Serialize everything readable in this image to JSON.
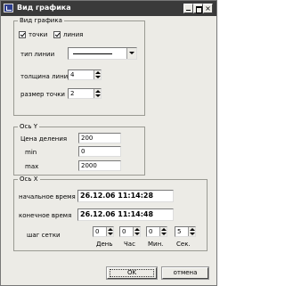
{
  "window": {
    "title": "Вид графика"
  },
  "view_group": {
    "legend": "Вид графика",
    "points_label": "точки",
    "line_label": "линия",
    "line_type_label": "тип линии",
    "line_width_label": "толщина линии",
    "line_width_value": "4",
    "point_size_label": "размер точки",
    "point_size_value": "2"
  },
  "y_group": {
    "legend": "Ось Y",
    "division_label": "Цена деления",
    "division_value": "200",
    "min_label": "min",
    "min_value": "0",
    "max_label": "max",
    "max_value": "2000"
  },
  "x_group": {
    "legend": "Ось X",
    "start_label": "начальное время",
    "start_value": "26.12.06 11:14:28",
    "end_label": "конечное время",
    "end_value": "26.12.06 11:14:48",
    "grid_step_label": "шаг сетки",
    "steps": [
      {
        "value": "0",
        "unit": "День"
      },
      {
        "value": "0",
        "unit": "Час"
      },
      {
        "value": "0",
        "unit": "Мин."
      },
      {
        "value": "5",
        "unit": "Сек."
      }
    ]
  },
  "buttons": {
    "ok": "OK",
    "cancel": "отмена"
  }
}
